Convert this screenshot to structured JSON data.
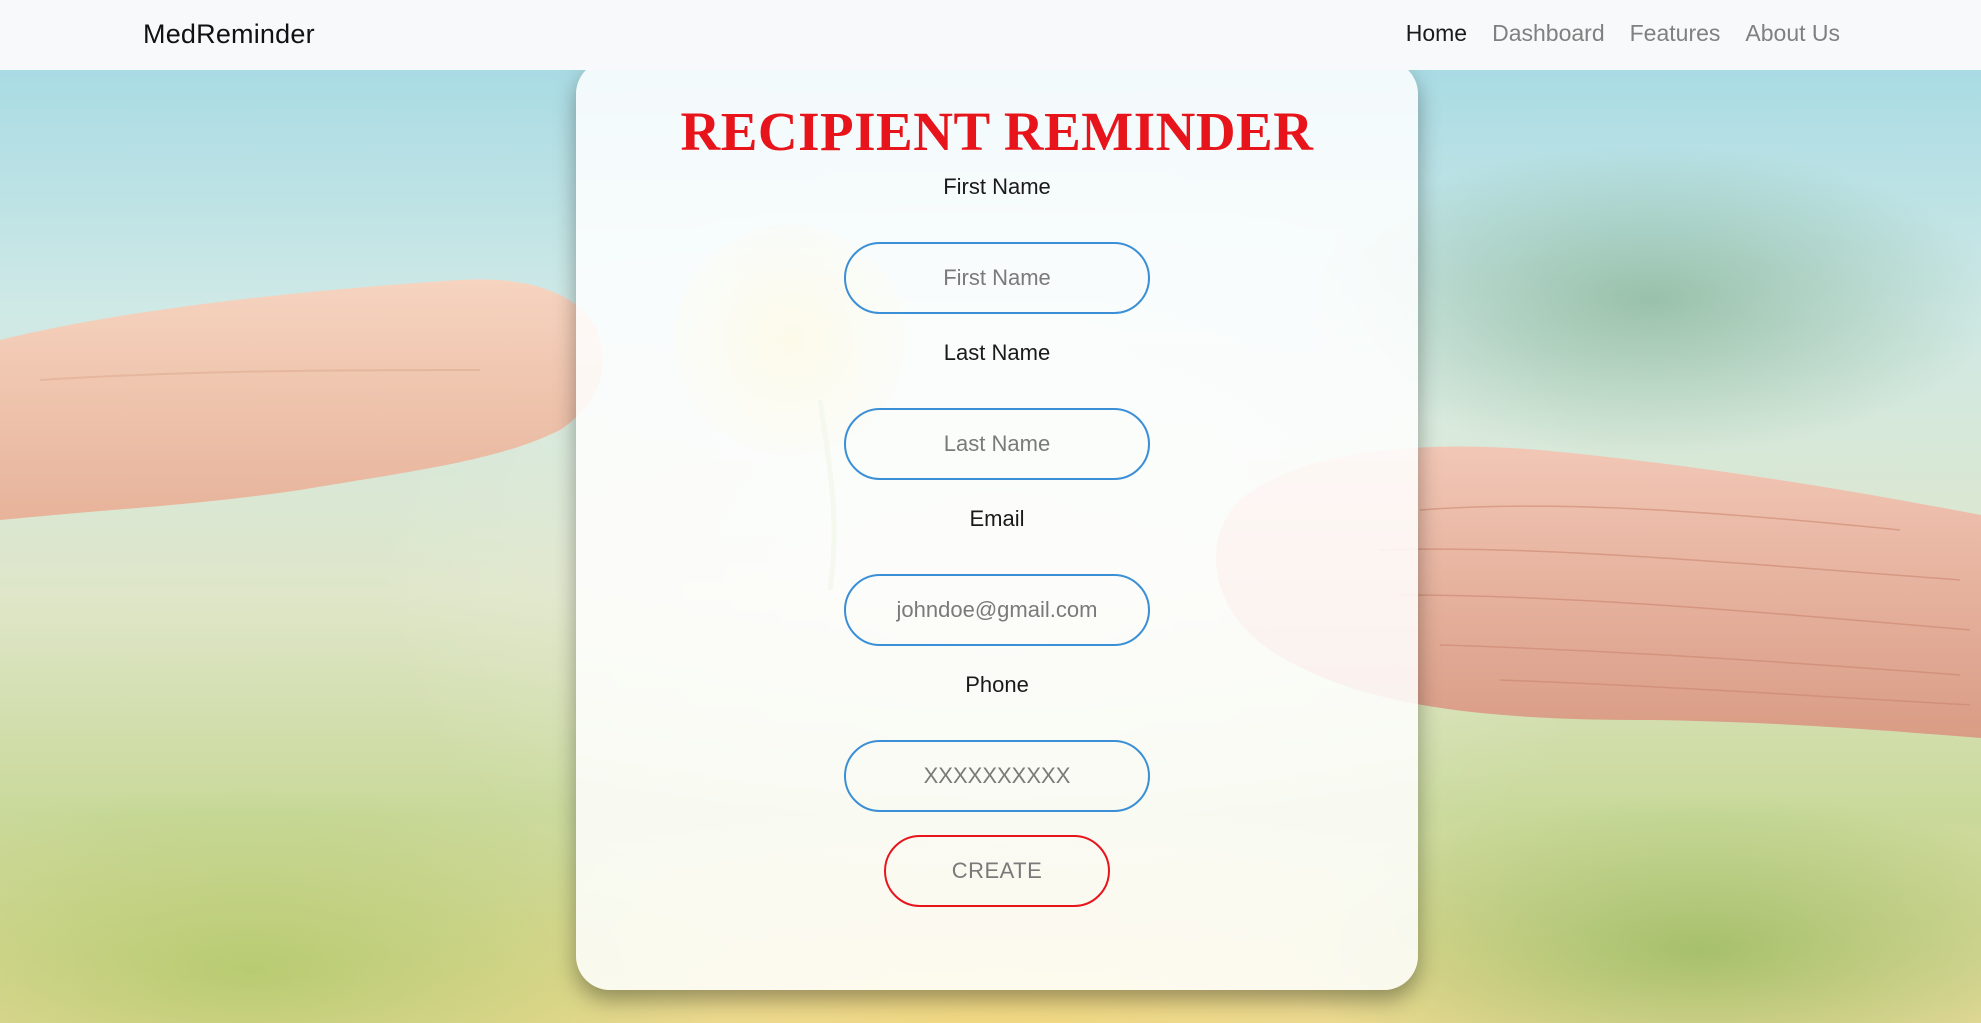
{
  "navbar": {
    "brand": "MedReminder",
    "links": [
      {
        "label": "Home",
        "active": true
      },
      {
        "label": "Dashboard",
        "active": false
      },
      {
        "label": "Features",
        "active": false
      },
      {
        "label": "About Us",
        "active": false
      }
    ]
  },
  "form": {
    "title": "RECIPIENT REMINDER",
    "fields": [
      {
        "label": "First Name",
        "placeholder": "First Name"
      },
      {
        "label": "Last Name",
        "placeholder": "Last Name"
      },
      {
        "label": "Email",
        "placeholder": "johndoe@gmail.com"
      },
      {
        "label": "Phone",
        "placeholder": "XXXXXXXXXX"
      }
    ],
    "submit_label": "CREATE"
  },
  "colors": {
    "title": "#e8141b",
    "input_border": "#3a8fd6",
    "button_border": "#e8141b",
    "navbar_bg": "#f8f9fa"
  }
}
